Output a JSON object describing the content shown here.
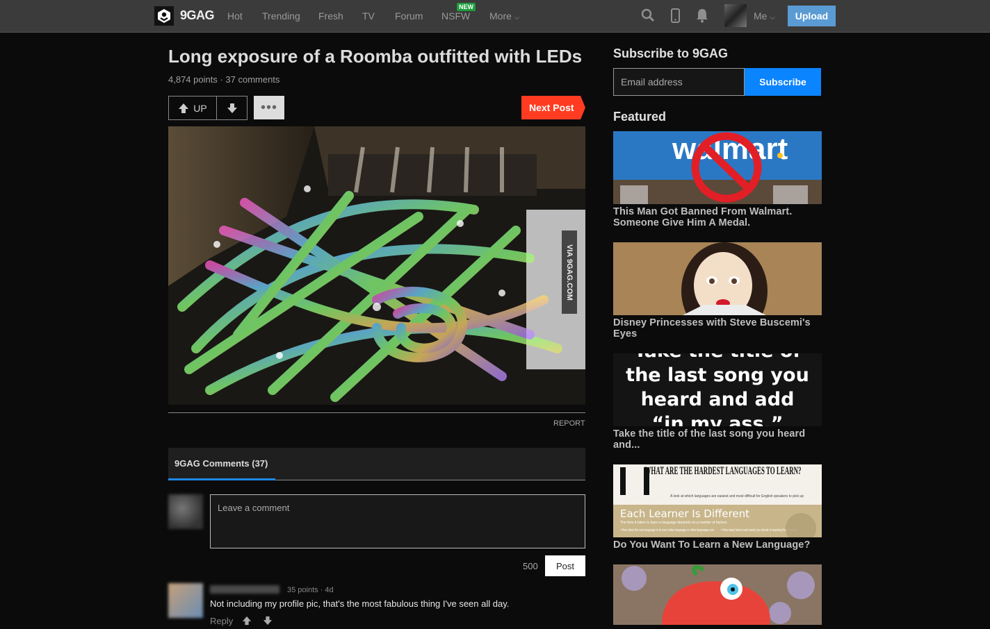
{
  "nav": {
    "logo_text": "9GAG",
    "links": [
      "Hot",
      "Trending",
      "Fresh",
      "TV",
      "Forum",
      "NSFW",
      "More"
    ],
    "new_badge": "NEW",
    "me_label": "Me",
    "upload_label": "Upload",
    "icons": [
      "search-icon",
      "mobile-icon",
      "bell-icon"
    ]
  },
  "post": {
    "title": "Long exposure of a Roomba outfitted with LEDs",
    "meta": "4,874 points · 37 comments",
    "up_label": "UP",
    "more_label": "•••",
    "next_label": "Next Post",
    "watermark": "VIA 9GAG.COM",
    "report_label": "REPORT",
    "accent_color": "#ff3c22"
  },
  "comments": {
    "tab_label": "9GAG Comments (37)",
    "placeholder": "Leave a comment",
    "char_count": "500",
    "post_label": "Post",
    "items": [
      {
        "meta": "35 points · 4d",
        "text": "Not including my profile pic, that's the most fabulous thing I've seen all day.",
        "reply_label": "Reply"
      }
    ]
  },
  "sidebar": {
    "subscribe_title": "Subscribe to 9GAG",
    "email_placeholder": "Email address",
    "subscribe_label": "Subscribe",
    "featured_title": "Featured",
    "featured": [
      {
        "caption": "This Man Got Banned From Walmart. Someone Give Him A Medal.",
        "thumb_text": "walmart"
      },
      {
        "caption": "Disney Princesses with Steve Buscemi's Eyes"
      },
      {
        "caption": "Take the title of the last song you heard and...",
        "thumb_lines": [
          "Take the title of",
          "the last song you",
          "heard and add",
          "“in my ass.”"
        ]
      },
      {
        "caption": "Do You Want To Learn a New Language?",
        "thumb_heading": "WHAT ARE THE HARDEST LANGUAGES TO LEARN?",
        "thumb_sub": "A look at which languages are easiest and most difficult for English speakers to pick up",
        "thumb_band": "Each Learner Is Different",
        "thumb_band_sub": "The time it takes to learn a language depends on a number of factors:",
        "thumb_bullets": [
          "• How close the new language is to your native language or other languages you",
          "• How many hours each week you devote to learning the language"
        ]
      },
      {
        "caption": ""
      }
    ]
  }
}
